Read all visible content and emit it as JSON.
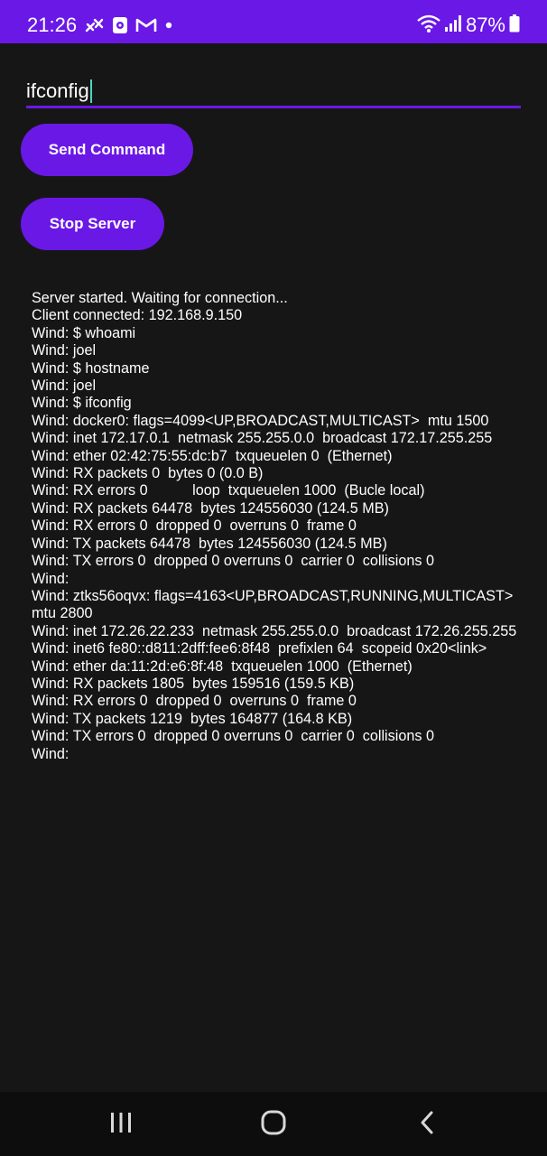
{
  "status_bar": {
    "time": "21:26",
    "notification_icons": [
      "missed-call-icon",
      "app-notification-icon",
      "gmail-icon",
      "dot-icon"
    ],
    "right_icons": [
      "wifi-icon",
      "signal-icon",
      "battery-icon"
    ],
    "battery_percent": "87%"
  },
  "command_input": {
    "value": "ifconfig",
    "placeholder": ""
  },
  "buttons": {
    "send_label": "Send Command",
    "stop_label": "Stop Server"
  },
  "log_lines": [
    "Server started. Waiting for connection...",
    "Client connected: 192.168.9.150",
    "Wind: $ whoami",
    "Wind: joel",
    "Wind: $ hostname",
    "Wind: joel",
    "Wind: $ ifconfig",
    "Wind: docker0: flags=4099<UP,BROADCAST,MULTICAST>  mtu 1500",
    "Wind: inet 172.17.0.1  netmask 255.255.0.0  broadcast 172.17.255.255",
    "Wind: ether 02:42:75:55:dc:b7  txqueuelen 0  (Ethernet)",
    "Wind: RX packets 0  bytes 0 (0.0 B)",
    "Wind: RX errors 0           loop  txqueuelen 1000  (Bucle local)",
    "Wind: RX packets 64478  bytes 124556030 (124.5 MB)",
    "Wind: RX errors 0  dropped 0  overruns 0  frame 0",
    "Wind: TX packets 64478  bytes 124556030 (124.5 MB)",
    "Wind: TX errors 0  dropped 0 overruns 0  carrier 0  collisions 0",
    "Wind:",
    "Wind: ztks56oqvx: flags=4163<UP,BROADCAST,RUNNING,MULTICAST>  mtu 2800",
    "Wind: inet 172.26.22.233  netmask 255.255.0.0  broadcast 172.26.255.255",
    "Wind: inet6 fe80::d811:2dff:fee6:8f48  prefixlen 64  scopeid 0x20<link>",
    "Wind: ether da:11:2d:e6:8f:48  txqueuelen 1000  (Ethernet)",
    "Wind: RX packets 1805  bytes 159516 (159.5 KB)",
    "Wind: RX errors 0  dropped 0  overruns 0  frame 0",
    "Wind: TX packets 1219  bytes 164877 (164.8 KB)",
    "Wind: TX errors 0  dropped 0 overruns 0  carrier 0  collisions 0",
    "Wind:"
  ],
  "nav_bar": {
    "icons": [
      "recents-icon",
      "home-icon",
      "back-icon"
    ]
  },
  "colors": {
    "accent": "#6a18e6",
    "background": "#161616",
    "nav_background": "#0d0d0d",
    "caret": "#4fd2c2",
    "text": "#ffffff"
  }
}
